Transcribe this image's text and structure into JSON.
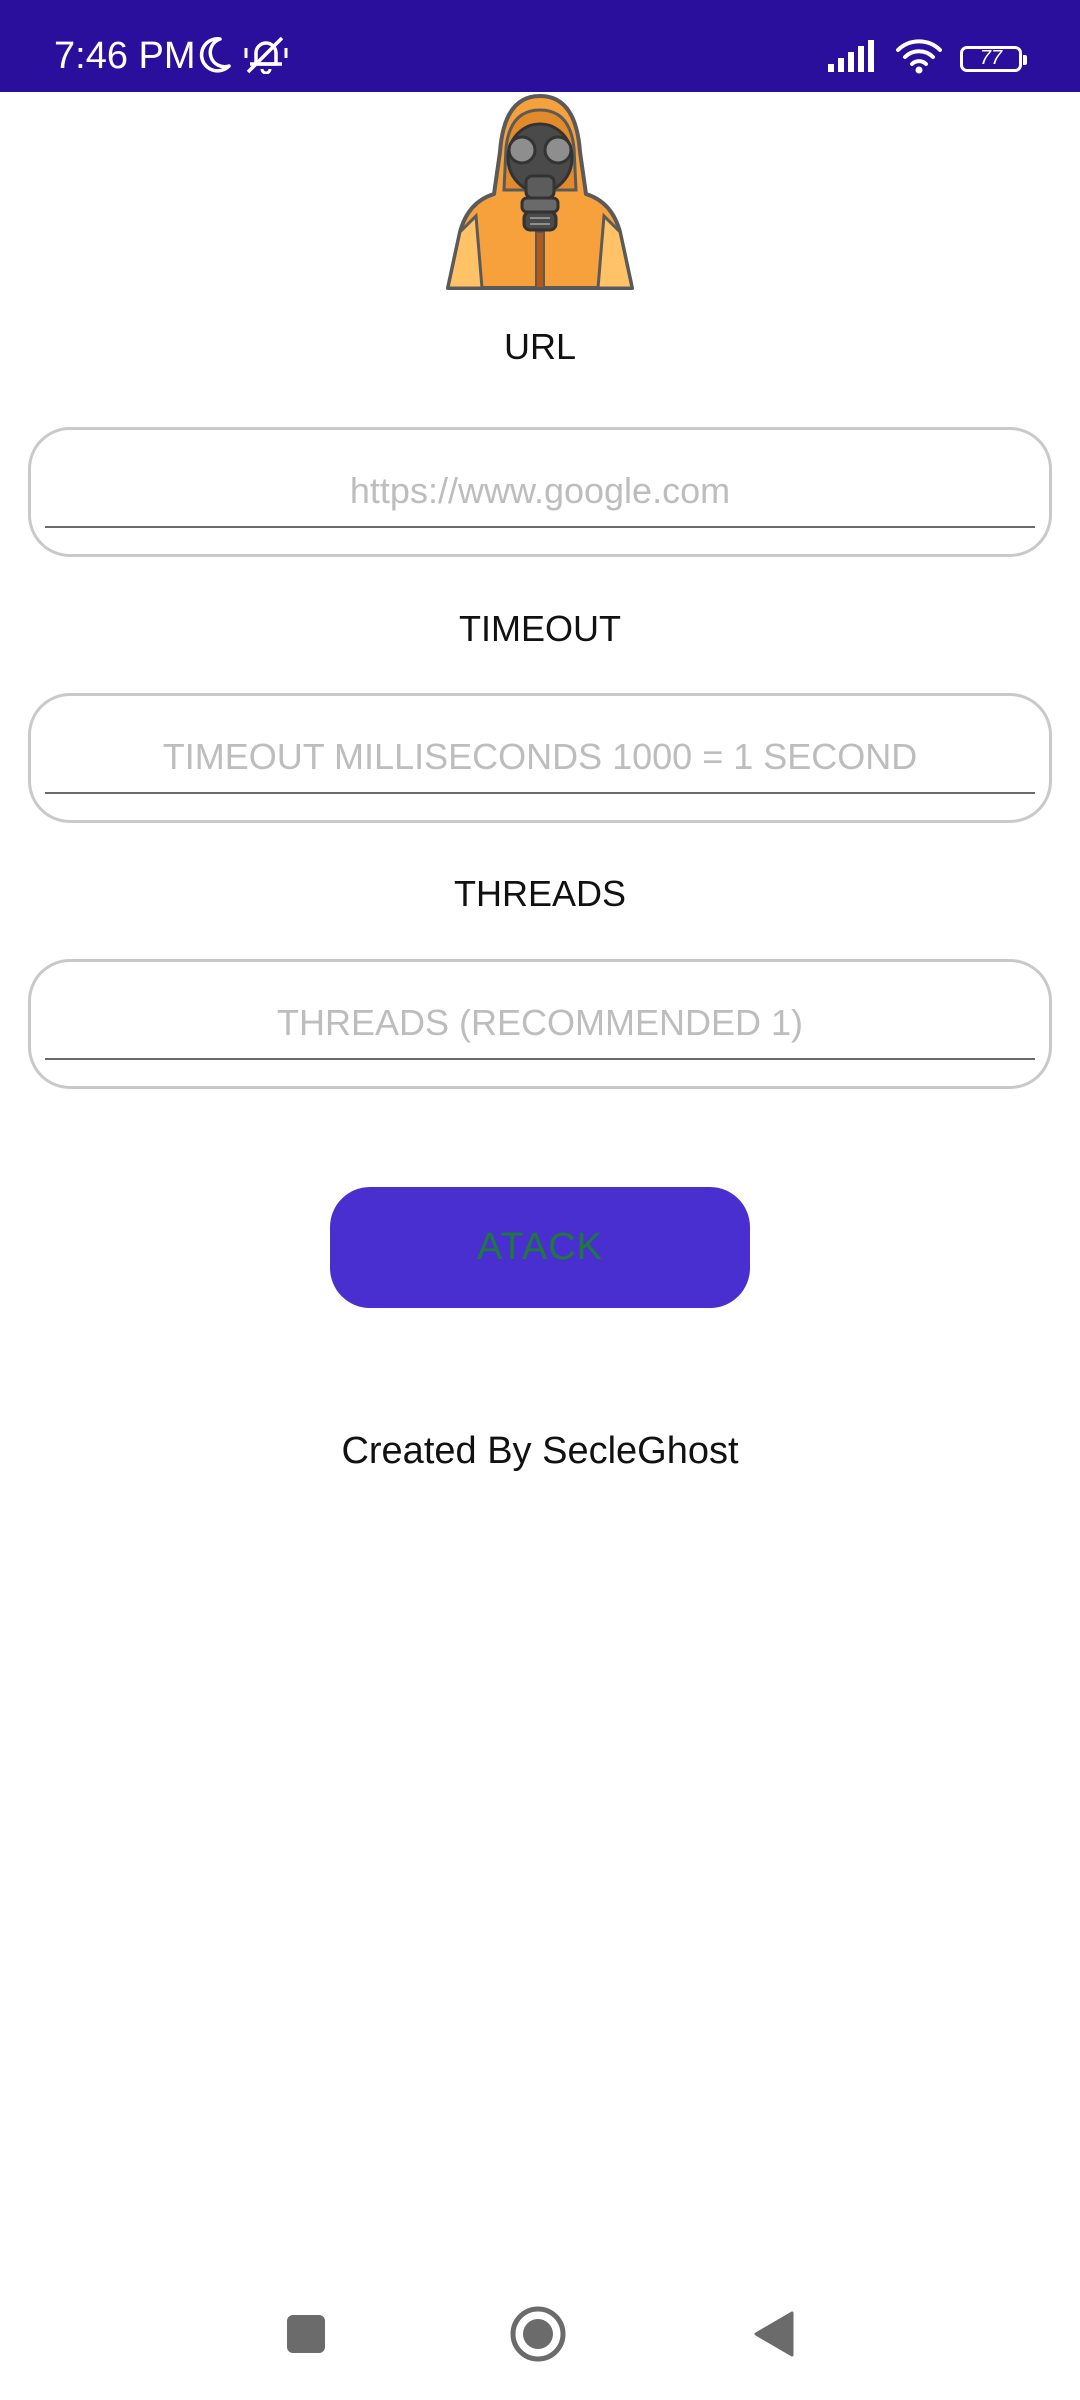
{
  "status_bar": {
    "time": "7:46 PM",
    "battery_level": "77",
    "background_color": "#2a0e9c",
    "icons_left": [
      "moon-icon",
      "vibrate-off-icon"
    ],
    "icons_right": [
      "signal-icon",
      "wifi-icon",
      "battery-icon"
    ]
  },
  "app": {
    "mascot_icon": "hazmat-gasmask-icon",
    "url_label": "URL",
    "url_placeholder": "https://www.google.com",
    "url_value": "",
    "timeout_label": "TIMEOUT",
    "timeout_placeholder": "TIMEOUT MILLISECONDS 1000 = 1 SECOND",
    "timeout_value": "",
    "threads_label": "THREADS",
    "threads_placeholder": "THREADS (RECOMMENDED 1)",
    "threads_value": "",
    "attack_label": "ATACK",
    "attack_button_color": "#4a2fd0",
    "attack_text_color": "#1e7a3a",
    "credits": "Created By SecleGhost"
  },
  "nav_bar": {
    "buttons": [
      "recents-square-icon",
      "home-circle-icon",
      "back-triangle-icon"
    ]
  }
}
